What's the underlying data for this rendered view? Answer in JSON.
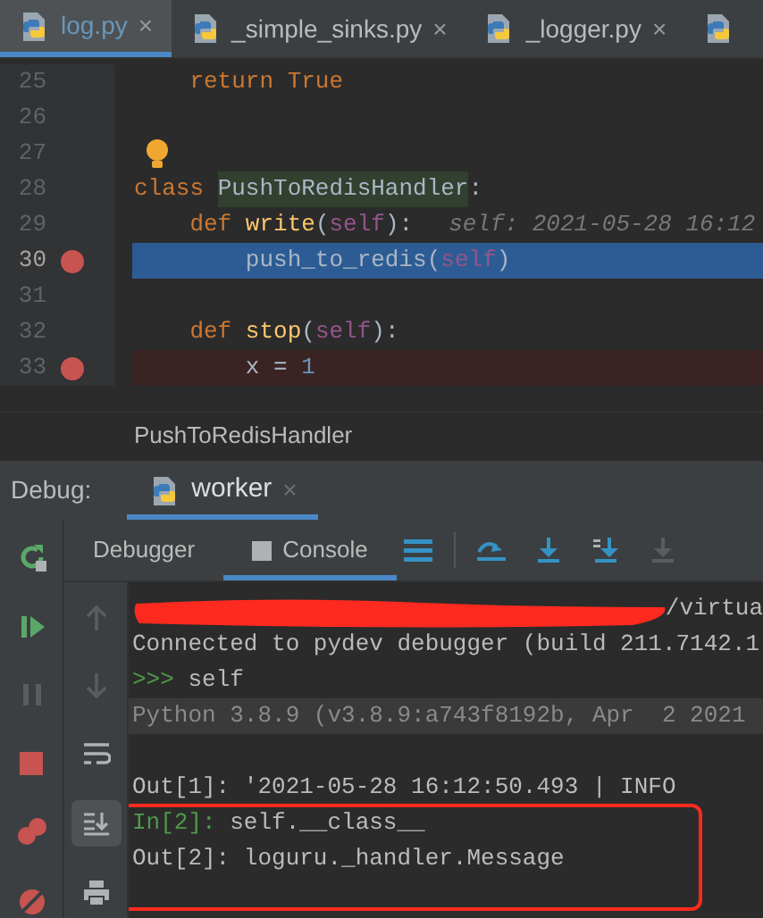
{
  "editor_tabs": [
    {
      "label": "log.py",
      "selected": true,
      "close": "×"
    },
    {
      "label": "_simple_sinks.py",
      "selected": false,
      "close": "×"
    },
    {
      "label": "_logger.py",
      "selected": false,
      "close": "×"
    },
    {
      "selected": false
    }
  ],
  "code_lines": [
    {
      "number": "25",
      "breakpoint": false,
      "current": false,
      "tokens": [
        {
          "kind": "keyword",
          "text": "    return True"
        }
      ]
    },
    {
      "number": "26",
      "breakpoint": false,
      "current": false
    },
    {
      "number": "27",
      "breakpoint": false,
      "current": false,
      "bulb": true
    },
    {
      "number": "28",
      "breakpoint": false,
      "current": false,
      "tokens": [
        {
          "kind": "keyword",
          "text": "class "
        },
        {
          "kind": "highlight",
          "text": "PushToRedisHandler"
        },
        {
          "kind": "plain",
          "text": ":"
        }
      ]
    },
    {
      "number": "29",
      "breakpoint": false,
      "current": false,
      "tokens": [
        {
          "kind": "keyword",
          "text": "    def "
        },
        {
          "kind": "function",
          "text": "write"
        },
        {
          "kind": "plain",
          "text": "("
        },
        {
          "kind": "self",
          "text": "self"
        },
        {
          "kind": "plain",
          "text": "):"
        },
        {
          "kind": "hint",
          "text": "self: 2021-05-28 16:12"
        }
      ]
    },
    {
      "number": "30",
      "breakpoint": true,
      "current": true,
      "tokens": [
        {
          "kind": "plain",
          "text": "        push_to_redis("
        },
        {
          "kind": "self",
          "text": "self"
        },
        {
          "kind": "plain",
          "text": ")"
        }
      ]
    },
    {
      "number": "31",
      "breakpoint": false,
      "current": false
    },
    {
      "number": "32",
      "breakpoint": false,
      "current": false,
      "tokens": [
        {
          "kind": "keyword",
          "text": "    def "
        },
        {
          "kind": "function",
          "text": "stop"
        },
        {
          "kind": "plain",
          "text": "("
        },
        {
          "kind": "self",
          "text": "self"
        },
        {
          "kind": "plain",
          "text": "):"
        }
      ]
    },
    {
      "number": "33",
      "breakpoint": true,
      "current": false,
      "tokens": [
        {
          "kind": "plain",
          "text": "        x = "
        },
        {
          "kind": "number",
          "text": "1"
        }
      ]
    }
  ],
  "breadcrumb": "PushToRedisHandler",
  "debug_bar": {
    "label": "Debug:",
    "tab": "worker",
    "close": "×"
  },
  "debug_tabs": [
    {
      "label": "Debugger",
      "selected": false
    },
    {
      "label": "Console",
      "selected": true
    }
  ],
  "console_lines": [
    {
      "kind": "redacted",
      "segments": [
        {
          "kind": "plain",
          "text": "/virtua"
        }
      ]
    },
    {
      "kind": "plain",
      "segments": [
        {
          "kind": "plain",
          "text": "Connected to pydev debugger (build 211.7142.1"
        }
      ]
    },
    {
      "kind": "plain",
      "segments": [
        {
          "kind": "prompt",
          "text": ">>> "
        },
        {
          "kind": "plain",
          "text": "self"
        }
      ]
    },
    {
      "kind": "banner",
      "segments": [
        {
          "kind": "plain",
          "text": "Python 3.8.9 (v3.8.9:a743f8192b, Apr  2 2021"
        }
      ]
    },
    {
      "kind": "plain"
    },
    {
      "kind": "plain",
      "segments": [
        {
          "kind": "plain",
          "text": "Out[1]: '2021-05-28 16:12:50.493 | INFO"
        }
      ]
    },
    {
      "kind": "plain",
      "segments": [
        {
          "kind": "prompt",
          "text": "In[2]: "
        },
        {
          "kind": "plain",
          "text": "self.__class__"
        }
      ]
    },
    {
      "kind": "plain",
      "segments": [
        {
          "kind": "plain",
          "text": "Out[2]: loguru._handler.Message"
        }
      ]
    }
  ]
}
